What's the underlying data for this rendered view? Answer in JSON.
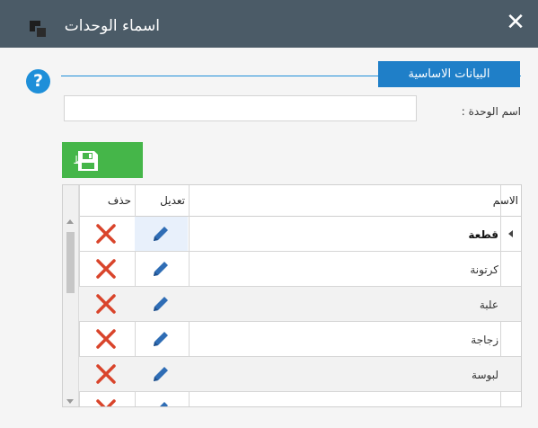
{
  "window": {
    "title": "اسماء الوحدات",
    "close_label": "✕"
  },
  "section": {
    "title": "البيانات الاساسية",
    "help_label": "?"
  },
  "form": {
    "unit_name_label": "اسم الوحدة :",
    "unit_name_value": ""
  },
  "toolbar": {
    "save_label": "حفظ"
  },
  "grid": {
    "columns": {
      "name": "الاسم",
      "edit": "تعديل",
      "delete": "حذف"
    },
    "rows": [
      {
        "name": "قطعة"
      },
      {
        "name": "كرتونة"
      },
      {
        "name": "علبة"
      },
      {
        "name": "زجاجة"
      },
      {
        "name": "لبوسة"
      },
      {
        "name": ""
      }
    ]
  },
  "colors": {
    "titlebar": "#4b5b67",
    "accent_blue": "#1e8fd9",
    "save_green": "#45b649",
    "edit_blue": "#2f6db5",
    "delete_red": "#d9442b"
  }
}
